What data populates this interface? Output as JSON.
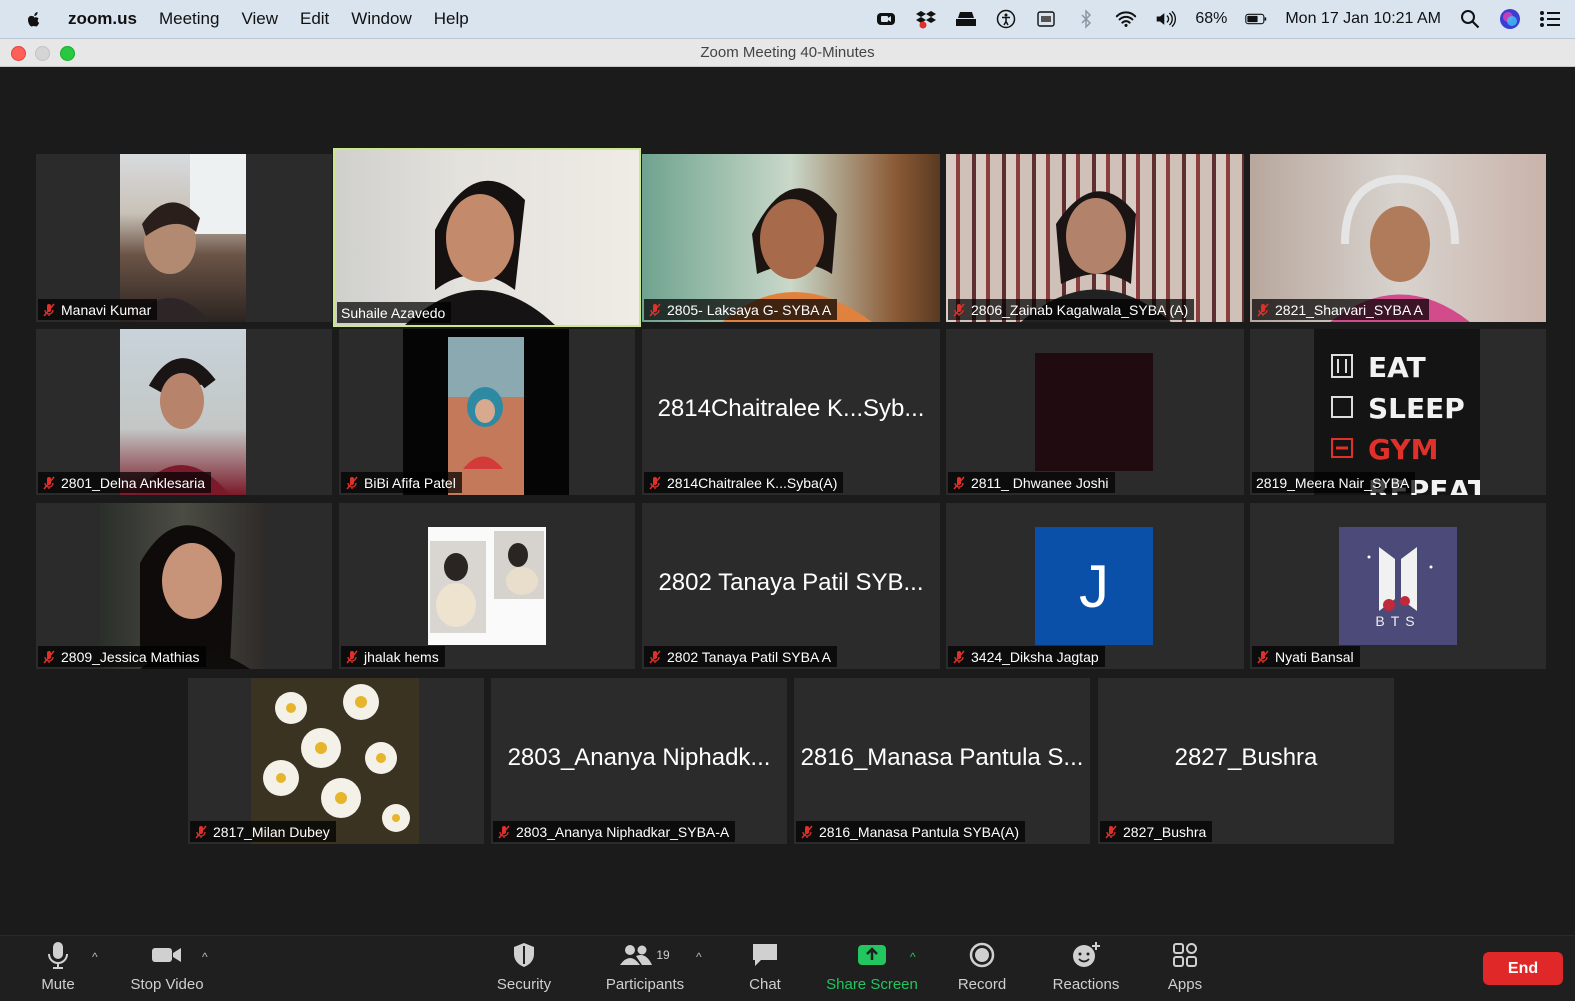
{
  "menubar": {
    "app_name": "zoom.us",
    "items": [
      "Meeting",
      "View",
      "Edit",
      "Window",
      "Help"
    ],
    "battery": "68%",
    "datetime": "Mon 17 Jan  10:21 AM"
  },
  "window": {
    "title": "Zoom Meeting   40-Minutes"
  },
  "participants": [
    {
      "name": "Manavi Kumar",
      "muted": true
    },
    {
      "name": "Suhaile Azavedo",
      "muted": false,
      "active_speaker": true
    },
    {
      "name": "2805- Laksaya G- SYBA A",
      "muted": true
    },
    {
      "name": "2806_Zainab Kagalwala_SYBA (A)",
      "muted": true
    },
    {
      "name": "2821_Sharvari_SYBA A",
      "muted": true
    },
    {
      "name": "2801_Delna Anklesaria",
      "muted": true
    },
    {
      "name": "BiBi Afifa Patel",
      "muted": true
    },
    {
      "name": "2814Chaitralee K...Syba(A)",
      "display_name": "2814Chaitralee K...Syb...",
      "muted": true
    },
    {
      "name": "2811_ Dhwanee Joshi",
      "muted": true
    },
    {
      "name": "2819_Meera Nair_SYBA",
      "muted": false,
      "image_text": [
        "EAT",
        "SLEEP",
        "GYM",
        "REPEAT"
      ]
    },
    {
      "name": "2809_Jessica Mathias",
      "muted": true
    },
    {
      "name": "jhalak hems",
      "muted": true
    },
    {
      "name": "2802 Tanaya Patil SYBA A",
      "display_name": "2802 Tanaya Patil SYB...",
      "muted": true
    },
    {
      "name": "3424_Diksha Jagtap",
      "muted": true,
      "avatar_letter": "J",
      "avatar_color": "#0a4fa8"
    },
    {
      "name": "Nyati Bansal",
      "muted": true,
      "image_text": [
        "BTS"
      ]
    },
    {
      "name": "2817_Milan Dubey",
      "muted": true
    },
    {
      "name": "2803_Ananya Niphadkar_SYBA-A",
      "display_name": "2803_Ananya Niphadk...",
      "muted": true
    },
    {
      "name": "2816_Manasa Pantula SYBA(A)",
      "display_name": "2816_Manasa Pantula S...",
      "muted": true
    },
    {
      "name": "2827_Bushra",
      "display_name": "2827_Bushra",
      "muted": true
    }
  ],
  "toolbar": {
    "mute": "Mute",
    "stop_video": "Stop Video",
    "security": "Security",
    "participants": "Participants",
    "participants_count": "19",
    "chat": "Chat",
    "share_screen": "Share Screen",
    "record": "Record",
    "reactions": "Reactions",
    "apps": "Apps",
    "end": "End"
  },
  "colors": {
    "active_speaker": "#cbe88c",
    "share_green": "#22c55e",
    "end_red": "#e02828",
    "mic_off_red": "#e0302a"
  }
}
